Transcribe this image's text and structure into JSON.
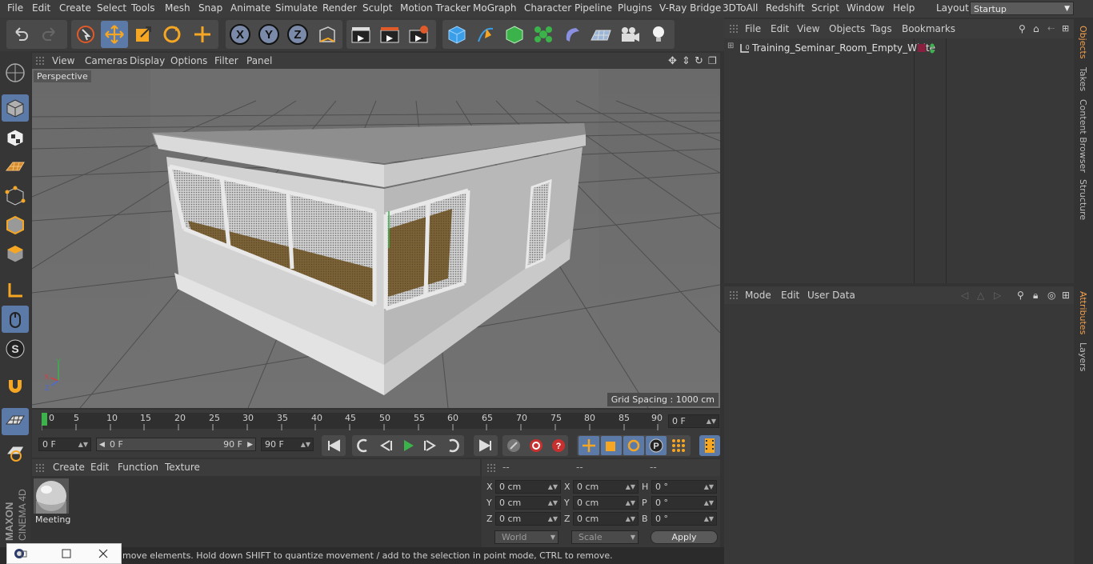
{
  "menubar": {
    "items": [
      "File",
      "Edit",
      "Create",
      "Select",
      "Tools",
      "Mesh",
      "Snap",
      "Animate",
      "Simulate",
      "Render",
      "Sculpt",
      "Motion Tracker",
      "MoGraph",
      "Character",
      "Pipeline",
      "Plugins",
      "V-Ray Bridge",
      "3DToAll",
      "Redshift",
      "Script",
      "Window",
      "Help"
    ],
    "layout_label": "Layout:",
    "layout_value": "Startup"
  },
  "toolbar": {
    "x_label": "X",
    "y_label": "Y",
    "z_label": "Z"
  },
  "viewport": {
    "menu": [
      "View",
      "Cameras",
      "Display",
      "Options",
      "Filter",
      "Panel"
    ],
    "label": "Perspective",
    "grid_spacing": "Grid Spacing : 1000 cm",
    "axis_y": "Y",
    "axis_x": "X",
    "axis_z": "Z"
  },
  "timeline": {
    "ticks": [
      "0",
      "5",
      "10",
      "15",
      "20",
      "25",
      "30",
      "35",
      "40",
      "45",
      "50",
      "55",
      "60",
      "65",
      "70",
      "75",
      "80",
      "85",
      "90"
    ],
    "current_frame_field": "0 F",
    "start_field": "0 F",
    "range_start": "0 F",
    "range_end": "90 F",
    "end_field": "90 F"
  },
  "material_panel": {
    "menu": [
      "Create",
      "Edit",
      "Function",
      "Texture"
    ],
    "material_name": "Meeting"
  },
  "coords": {
    "headers": [
      "--",
      "--",
      "--"
    ],
    "pos": [
      {
        "axis": "X",
        "value": "0 cm"
      },
      {
        "axis": "Y",
        "value": "0 cm"
      },
      {
        "axis": "Z",
        "value": "0 cm"
      }
    ],
    "size": [
      {
        "axis": "X",
        "value": "0 cm"
      },
      {
        "axis": "Y",
        "value": "0 cm"
      },
      {
        "axis": "Z",
        "value": "0 cm"
      }
    ],
    "rot": [
      {
        "axis": "H",
        "value": "0 °"
      },
      {
        "axis": "P",
        "value": "0 °"
      },
      {
        "axis": "B",
        "value": "0 °"
      }
    ],
    "space": "World",
    "mode": "Scale",
    "apply": "Apply"
  },
  "status": "move elements. Hold down SHIFT to quantize movement / add to the selection in point mode, CTRL to remove.",
  "objects_panel": {
    "menu": [
      "File",
      "Edit",
      "View",
      "Objects",
      "Tags",
      "Bookmarks"
    ],
    "object_name": "Training_Seminar_Room_Empty_White"
  },
  "attributes_panel": {
    "menu": [
      "Mode",
      "Edit",
      "User Data"
    ]
  },
  "right_tabs": [
    "Objects",
    "Takes",
    "Content Browser",
    "Structure",
    "Attributes",
    "Layers"
  ],
  "branding": {
    "brand": "MAXON",
    "product": "CINEMA 4D"
  },
  "colors": {
    "accent": "#5b7aa8",
    "active_tab": "#f0a050",
    "play": "#3cb24a"
  }
}
